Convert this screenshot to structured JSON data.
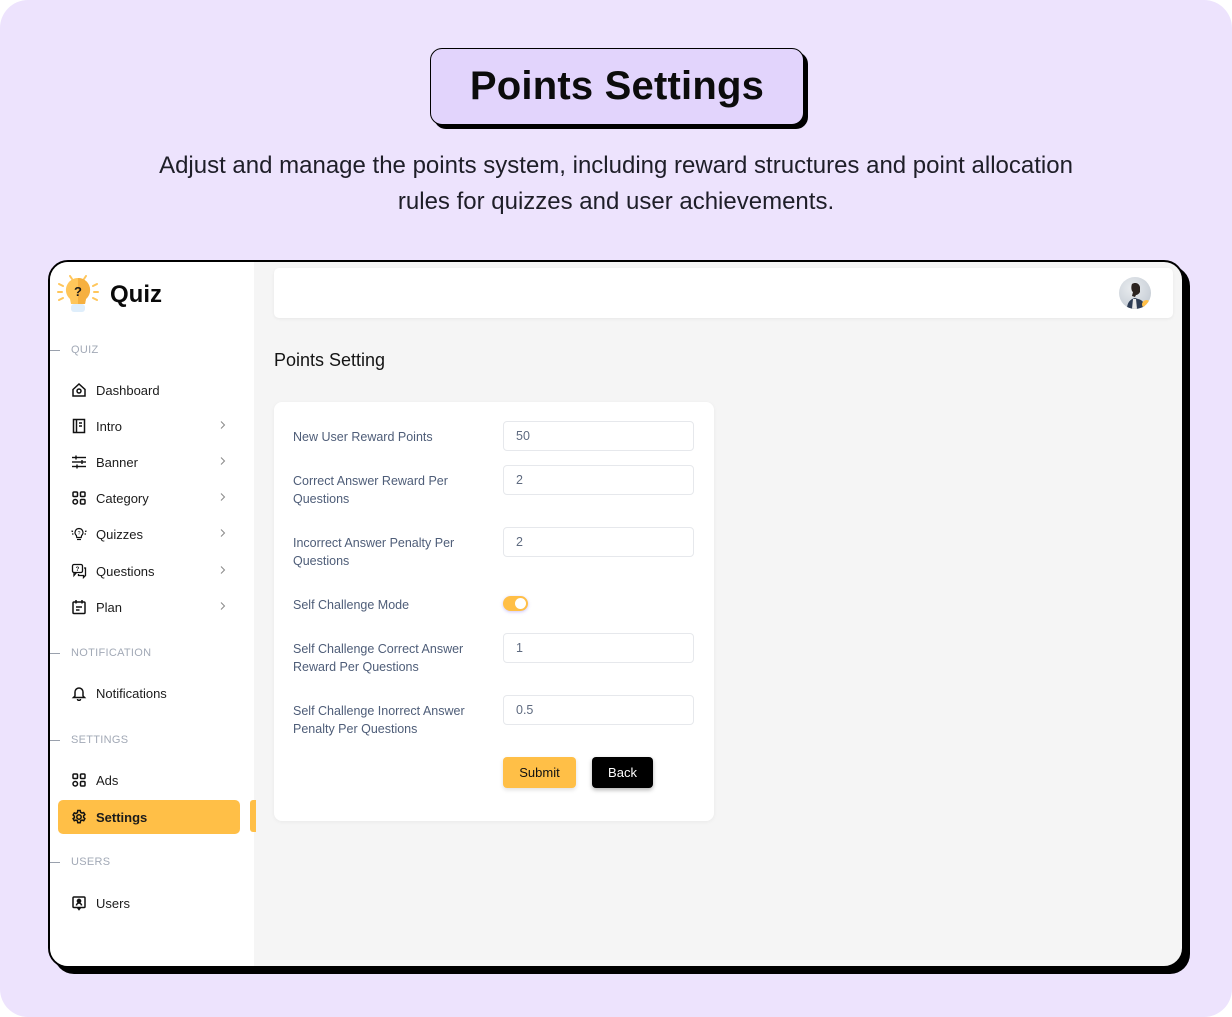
{
  "hero": {
    "title": "Points Settings",
    "subtitle": "Adjust and manage the points system, including reward structures and point allocation rules for quizzes and user achievements."
  },
  "app": {
    "name": "Quiz",
    "logo_icon": "lightbulb-question-icon"
  },
  "sidebar": {
    "sections": [
      {
        "label": "QUIZ",
        "items": [
          {
            "label": "Dashboard",
            "icon": "home-icon",
            "has_submenu": false
          },
          {
            "label": "Intro",
            "icon": "notebook-icon",
            "has_submenu": true
          },
          {
            "label": "Banner",
            "icon": "sliders-icon",
            "has_submenu": true
          },
          {
            "label": "Category",
            "icon": "grid-icon",
            "has_submenu": true
          },
          {
            "label": "Quizzes",
            "icon": "lightbulb-icon",
            "has_submenu": true
          },
          {
            "label": "Questions",
            "icon": "chat-question-icon",
            "has_submenu": true
          },
          {
            "label": "Plan",
            "icon": "calendar-icon",
            "has_submenu": true
          }
        ]
      },
      {
        "label": "NOTIFICATION",
        "items": [
          {
            "label": "Notifications",
            "icon": "bell-icon",
            "has_submenu": false
          }
        ]
      },
      {
        "label": "SETTINGS",
        "items": [
          {
            "label": "Ads",
            "icon": "grid-icon",
            "has_submenu": false
          },
          {
            "label": "Settings",
            "icon": "gear-icon",
            "has_submenu": false,
            "active": true
          }
        ]
      },
      {
        "label": "USERS",
        "items": [
          {
            "label": "Users",
            "icon": "user-badge-icon",
            "has_submenu": false
          }
        ]
      }
    ]
  },
  "topbar": {
    "avatar_status_color": "#ffbf47"
  },
  "main": {
    "heading": "Points Setting",
    "form": {
      "fields": [
        {
          "label": "New User Reward Points",
          "value": "50"
        },
        {
          "label": "Correct Answer Reward Per Questions",
          "value": "2"
        },
        {
          "label": "Incorrect Answer Penalty Per Questions",
          "value": "2"
        },
        {
          "label": "Self Challenge Mode",
          "type": "toggle",
          "value": true
        },
        {
          "label": "Self Challenge Correct Answer Reward Per Questions",
          "value": "1"
        },
        {
          "label": "Self Challenge Inorrect Answer Penalty Per Questions",
          "value": "0.5"
        }
      ],
      "submit_label": "Submit",
      "back_label": "Back"
    }
  },
  "colors": {
    "accent": "#ffbf47",
    "background": "#ede3fd",
    "title_badge": "#e2d4fc",
    "label_text": "#4e5d78"
  }
}
